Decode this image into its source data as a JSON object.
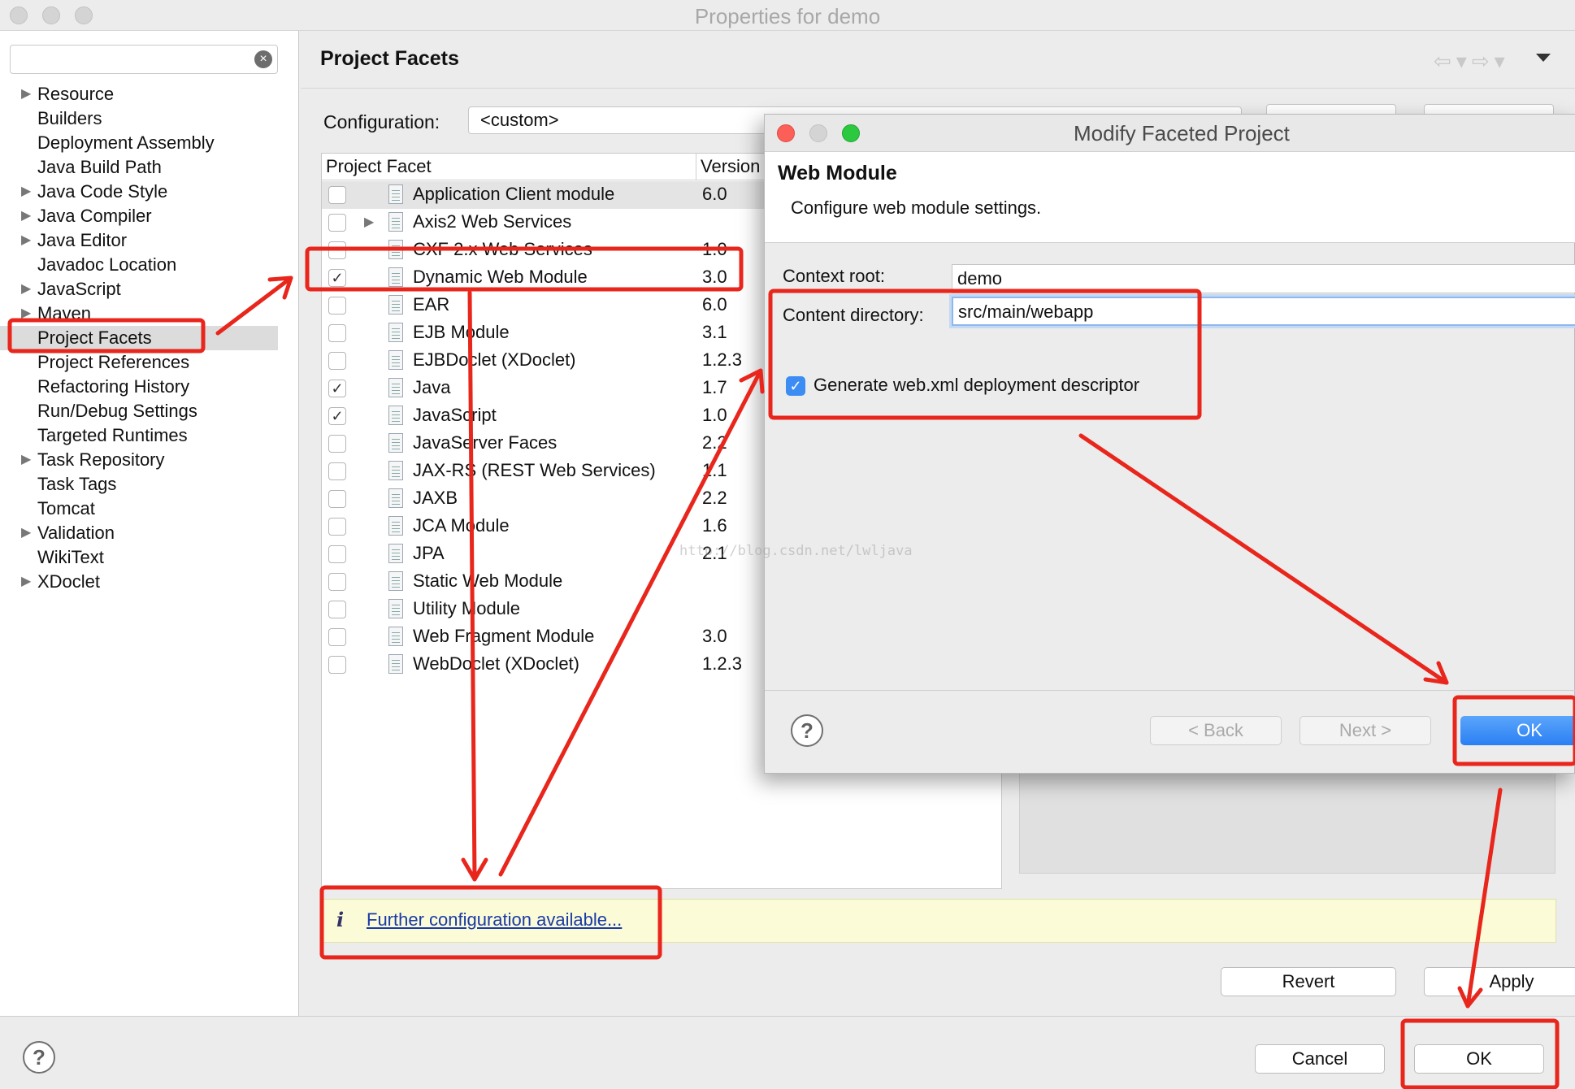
{
  "window": {
    "title": "Properties for demo"
  },
  "sidebar": {
    "filter_placeholder": "",
    "items": [
      {
        "label": "Resource",
        "expandable": true
      },
      {
        "label": "Builders",
        "expandable": false
      },
      {
        "label": "Deployment Assembly",
        "expandable": false
      },
      {
        "label": "Java Build Path",
        "expandable": false
      },
      {
        "label": "Java Code Style",
        "expandable": true
      },
      {
        "label": "Java Compiler",
        "expandable": true
      },
      {
        "label": "Java Editor",
        "expandable": true
      },
      {
        "label": "Javadoc Location",
        "expandable": false
      },
      {
        "label": "JavaScript",
        "expandable": true
      },
      {
        "label": "Maven",
        "expandable": true
      },
      {
        "label": "Project Facets",
        "expandable": false,
        "selected": true
      },
      {
        "label": "Project References",
        "expandable": false
      },
      {
        "label": "Refactoring History",
        "expandable": false
      },
      {
        "label": "Run/Debug Settings",
        "expandable": false
      },
      {
        "label": "Targeted Runtimes",
        "expandable": false
      },
      {
        "label": "Task Repository",
        "expandable": true
      },
      {
        "label": "Task Tags",
        "expandable": false
      },
      {
        "label": "Tomcat",
        "expandable": false
      },
      {
        "label": "Validation",
        "expandable": true
      },
      {
        "label": "WikiText",
        "expandable": false
      },
      {
        "label": "XDoclet",
        "expandable": true
      }
    ]
  },
  "main": {
    "title": "Project Facets",
    "configuration_label": "Configuration:",
    "configuration_value": "<custom>",
    "table": {
      "col_facet": "Project Facet",
      "col_version": "Version",
      "rows": [
        {
          "name": "Application Client module",
          "version": "6.0",
          "checked": false
        },
        {
          "name": "Axis2 Web Services",
          "version": "",
          "checked": false,
          "expandable": true
        },
        {
          "name": "CXF 2.x Web Services",
          "version": "1.0",
          "checked": false
        },
        {
          "name": "Dynamic Web Module",
          "version": "3.0",
          "checked": true
        },
        {
          "name": "EAR",
          "version": "6.0",
          "checked": false
        },
        {
          "name": "EJB Module",
          "version": "3.1",
          "checked": false
        },
        {
          "name": "EJBDoclet (XDoclet)",
          "version": "1.2.3",
          "checked": false
        },
        {
          "name": "Java",
          "version": "1.7",
          "checked": true
        },
        {
          "name": "JavaScript",
          "version": "1.0",
          "checked": true
        },
        {
          "name": "JavaServer Faces",
          "version": "2.2",
          "checked": false
        },
        {
          "name": "JAX-RS (REST Web Services)",
          "version": "1.1",
          "checked": false
        },
        {
          "name": "JAXB",
          "version": "2.2",
          "checked": false
        },
        {
          "name": "JCA Module",
          "version": "1.6",
          "checked": false
        },
        {
          "name": "JPA",
          "version": "2.1",
          "checked": false
        },
        {
          "name": "Static Web Module",
          "version": "",
          "checked": false
        },
        {
          "name": "Utility Module",
          "version": "",
          "checked": false
        },
        {
          "name": "Web Fragment Module",
          "version": "3.0",
          "checked": false
        },
        {
          "name": "WebDoclet (XDoclet)",
          "version": "1.2.3",
          "checked": false
        }
      ]
    },
    "info_link": "Further configuration available...",
    "revert_label": "Revert",
    "apply_label": "Apply"
  },
  "footer": {
    "cancel_label": "Cancel",
    "ok_label": "OK"
  },
  "dialog": {
    "title": "Modify Faceted Project",
    "heading": "Web Module",
    "description": "Configure web module settings.",
    "context_root_label": "Context root:",
    "context_root_value": "demo",
    "content_dir_label": "Content directory:",
    "content_dir_value": "src/main/webapp",
    "generate_label": "Generate web.xml deployment descriptor",
    "generate_checked": true,
    "back_label": "< Back",
    "next_label": "Next >",
    "ok_label": "OK"
  },
  "watermark": "http://blog.csdn.net/lwljava",
  "colors": {
    "annotation_red": "#e8261c",
    "primary_blue": "#2a7ff3",
    "info_bg": "#fbfbd8"
  }
}
